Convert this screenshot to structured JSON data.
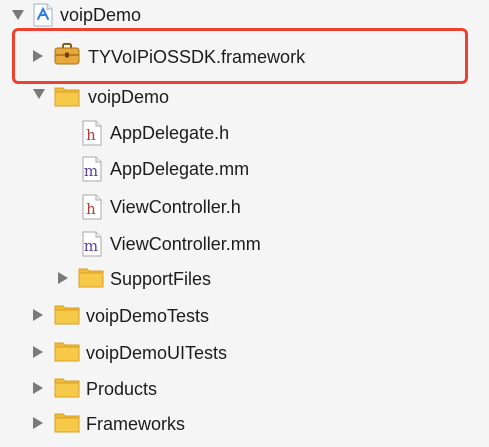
{
  "navigator": {
    "project": {
      "label": "voipDemo"
    },
    "framework": {
      "label": "TYVoIPiOSSDK.framework"
    },
    "group": {
      "label": "voipDemo"
    },
    "files": [
      {
        "label": "AppDelegate.h",
        "type": "h"
      },
      {
        "label": "AppDelegate.mm",
        "type": "m"
      },
      {
        "label": "ViewController.h",
        "type": "h"
      },
      {
        "label": "ViewController.mm",
        "type": "m"
      }
    ],
    "support_files": {
      "label": "SupportFiles"
    },
    "tests": {
      "label": "voipDemoTests"
    },
    "ui_tests": {
      "label": "voipDemoUITests"
    },
    "products": {
      "label": "Products"
    },
    "frameworks": {
      "label": "Frameworks"
    }
  },
  "colors": {
    "highlight": "#ef4130",
    "folder": "#f7c948",
    "header_letter": "#b03a3a",
    "impl_letter": "#5a3f9e"
  },
  "icons": {
    "project": "xcode-project-icon",
    "framework": "framework-toolbox-icon",
    "folder": "folder-icon",
    "header_file": "header-file-icon",
    "implementation_file": "implementation-file-icon"
  }
}
